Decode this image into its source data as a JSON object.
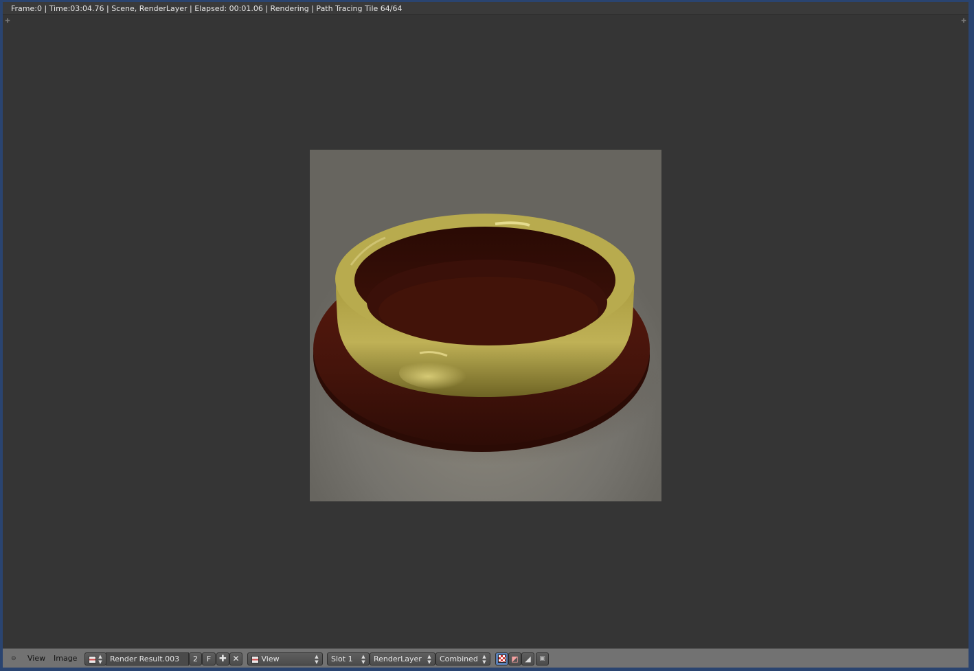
{
  "status_bar": {
    "text": "Frame:0 |  Time:03:04.76 | Scene, RenderLayer | Elapsed: 00:01.06 | Rendering | Path Tracing Tile 64/64"
  },
  "header": {
    "menu_view": "View",
    "menu_image": "Image",
    "image_name": "Render Result.003",
    "users_count": "2",
    "fake_user": "F",
    "view_select": "View",
    "slot_select": "Slot 1",
    "layer_select": "RenderLayer",
    "pass_select": "Combined"
  },
  "colors": {
    "viewport_bg": "#353535",
    "header_bg": "#727272",
    "ring_gold": "#b5a84a",
    "base_red": "#4a150c"
  }
}
